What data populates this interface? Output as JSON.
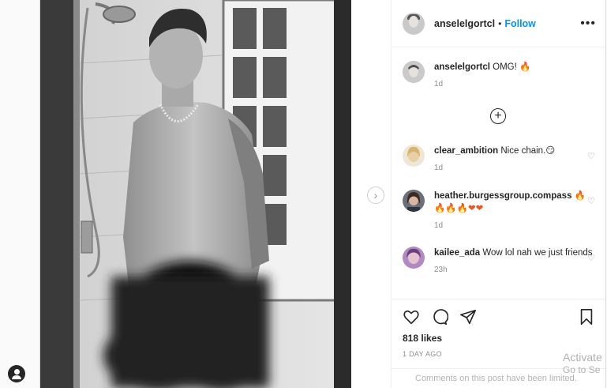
{
  "post": {
    "username": "anselelgortcl",
    "separator": "•",
    "follow_label": "Follow",
    "more_label": "•••"
  },
  "caption": {
    "username": "anselelgortcl",
    "text": "OMG! 🔥",
    "time": "1d"
  },
  "load_more_label": "+",
  "comments": [
    {
      "username": "clear_ambition",
      "text": "Nice chain.😏",
      "time": "1d"
    },
    {
      "username": "heather.burgessgroup.compass",
      "text": "🔥",
      "text2": "🔥🔥🔥❤❤",
      "time": "1d"
    },
    {
      "username": "kailee_ada",
      "text": "Wow lol nah we just friends",
      "time": "23h"
    }
  ],
  "actions": {
    "likes": "818 likes",
    "date": "1 DAY AGO",
    "comments_limited": "Comments on this post have been limited."
  },
  "next_arrow": "›",
  "watermark": {
    "line1": "Activate",
    "line2": "Go to Se"
  },
  "colors": {
    "follow": "#0095f6",
    "muted": "#8e8e8e",
    "border": "#efefef"
  }
}
